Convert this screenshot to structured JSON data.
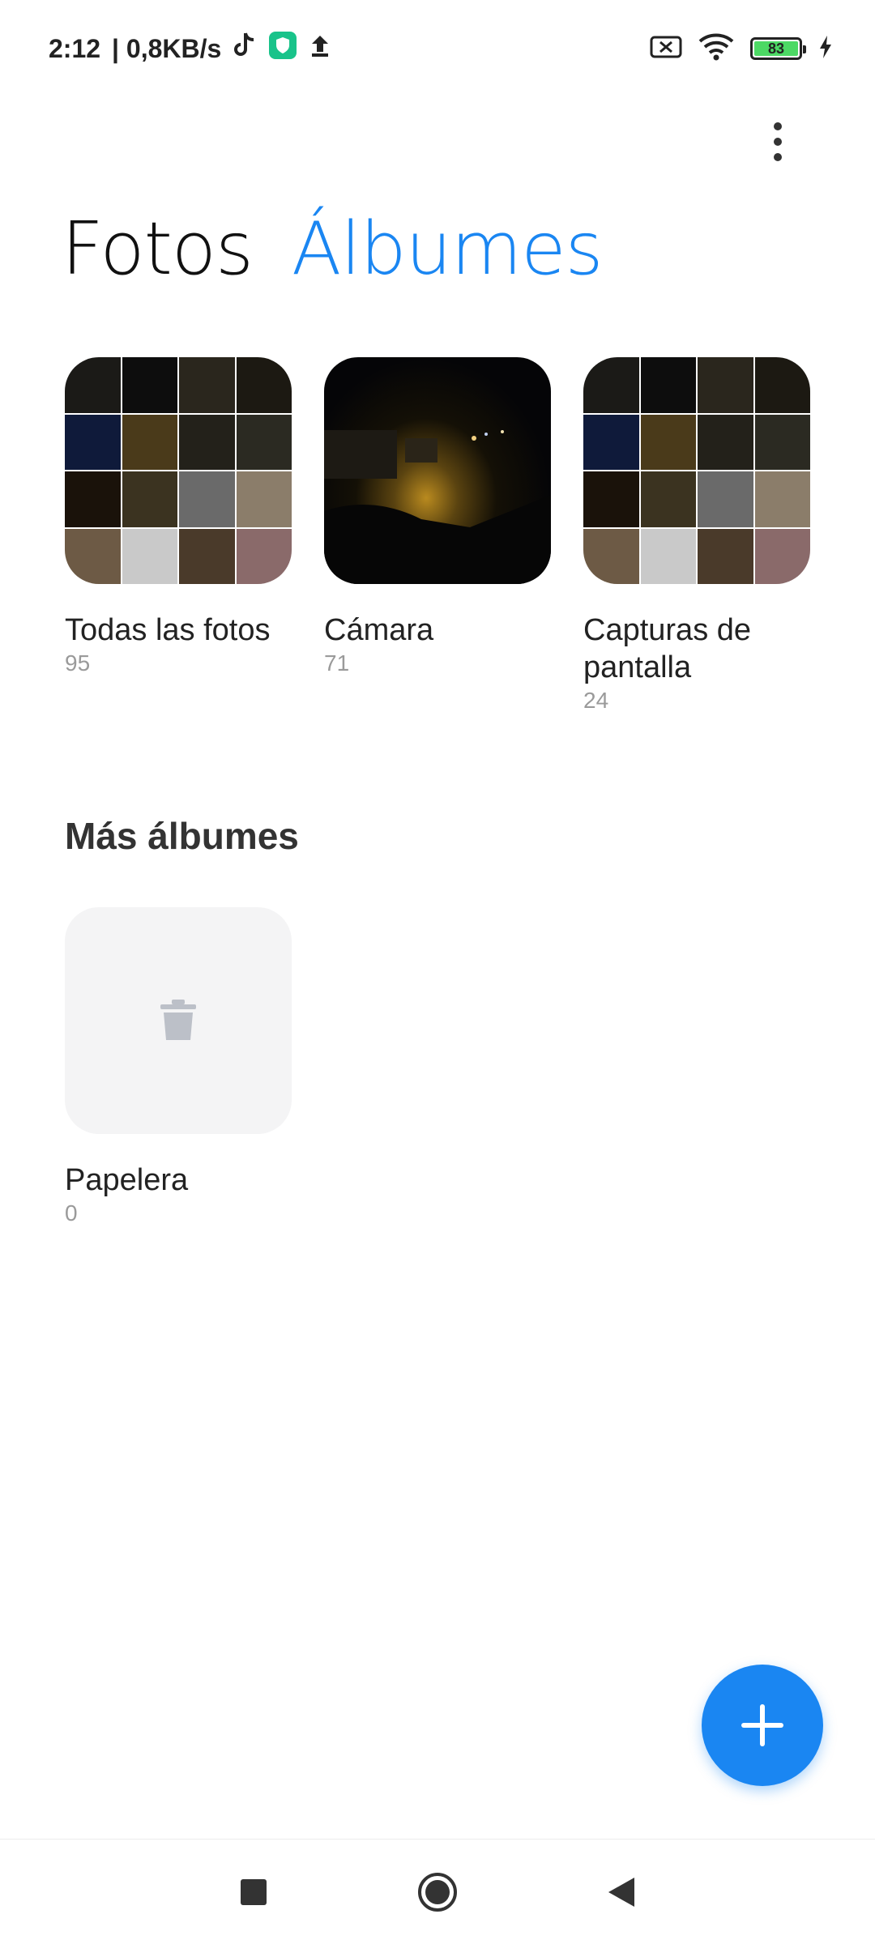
{
  "status_bar": {
    "time": "2:12",
    "network_speed": "| 0,8KB/s",
    "battery_level": "83",
    "icons": [
      "tiktok-icon",
      "shield-app-icon",
      "upload-icon",
      "sim-off-icon",
      "wifi-icon",
      "battery-icon",
      "charging-icon"
    ]
  },
  "header": {
    "tab_photos": "Fotos",
    "tab_albums": "Álbumes",
    "menu_icon": "more-vertical-icon",
    "active_color": "#1a86f2"
  },
  "albums": [
    {
      "title": "Todas las fotos",
      "count": "95"
    },
    {
      "title": "Cámara",
      "count": "71"
    },
    {
      "title": "Capturas de pantalla",
      "count": "24"
    }
  ],
  "more_albums": {
    "title": "Más álbumes",
    "items": [
      {
        "title": "Papelera",
        "count": "0",
        "icon": "trash-icon"
      }
    ]
  },
  "fab": {
    "icon": "plus-icon",
    "color": "#1a86f2"
  },
  "nav": {
    "icons": [
      "recents-square-icon",
      "home-circle-icon",
      "back-triangle-icon"
    ]
  }
}
